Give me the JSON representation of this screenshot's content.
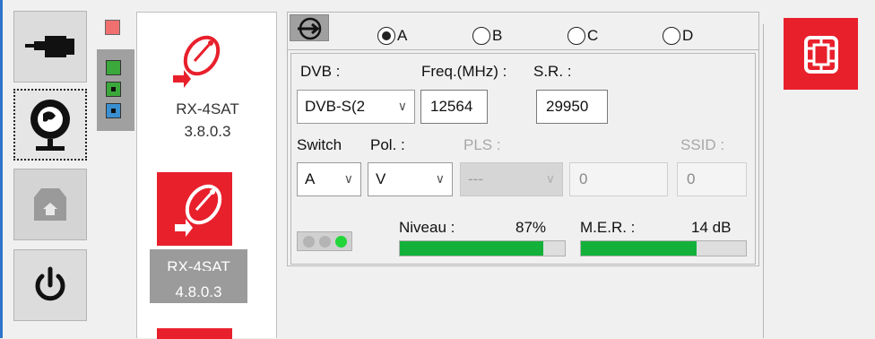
{
  "colors": {
    "accent_red": "#e8202c",
    "signal_green": "#13b13a",
    "sidebar_blue": "#2e74c9"
  },
  "toolbar": {
    "buttons": [
      {
        "icon": "usb-plug-icon"
      },
      {
        "icon": "satellite-dish-globe-icon"
      },
      {
        "icon": "home-box-icon"
      },
      {
        "icon": "power-icon"
      }
    ]
  },
  "devices": [
    {
      "name": "RX-4SAT",
      "version": "3.8.0.3",
      "selected": false
    },
    {
      "name": "RX-4SAT",
      "version": "4.8.0.3",
      "selected": true
    }
  ],
  "inputs": {
    "options": [
      "A",
      "B",
      "C",
      "D"
    ],
    "selected": "A"
  },
  "tuner": {
    "dvb_label": "DVB :",
    "dvb_value": "DVB-S(2",
    "freq_label": "Freq.(MHz) :",
    "freq_value": "12564",
    "sr_label": "S.R. :",
    "sr_value": "29950",
    "switch_label": "Switch",
    "switch_value": "A",
    "pol_label": "Pol. :",
    "pol_value": "V",
    "pls_label": "PLS :",
    "pls_mode": "---",
    "pls_value": "0",
    "ssid_label": "SSID :",
    "ssid_value": "0"
  },
  "signal": {
    "niveau_label": "Niveau :",
    "niveau_value": "87%",
    "niveau_fraction": 0.87,
    "mer_label": "M.E.R. :",
    "mer_value": "14 dB",
    "mer_fraction": 0.7
  }
}
